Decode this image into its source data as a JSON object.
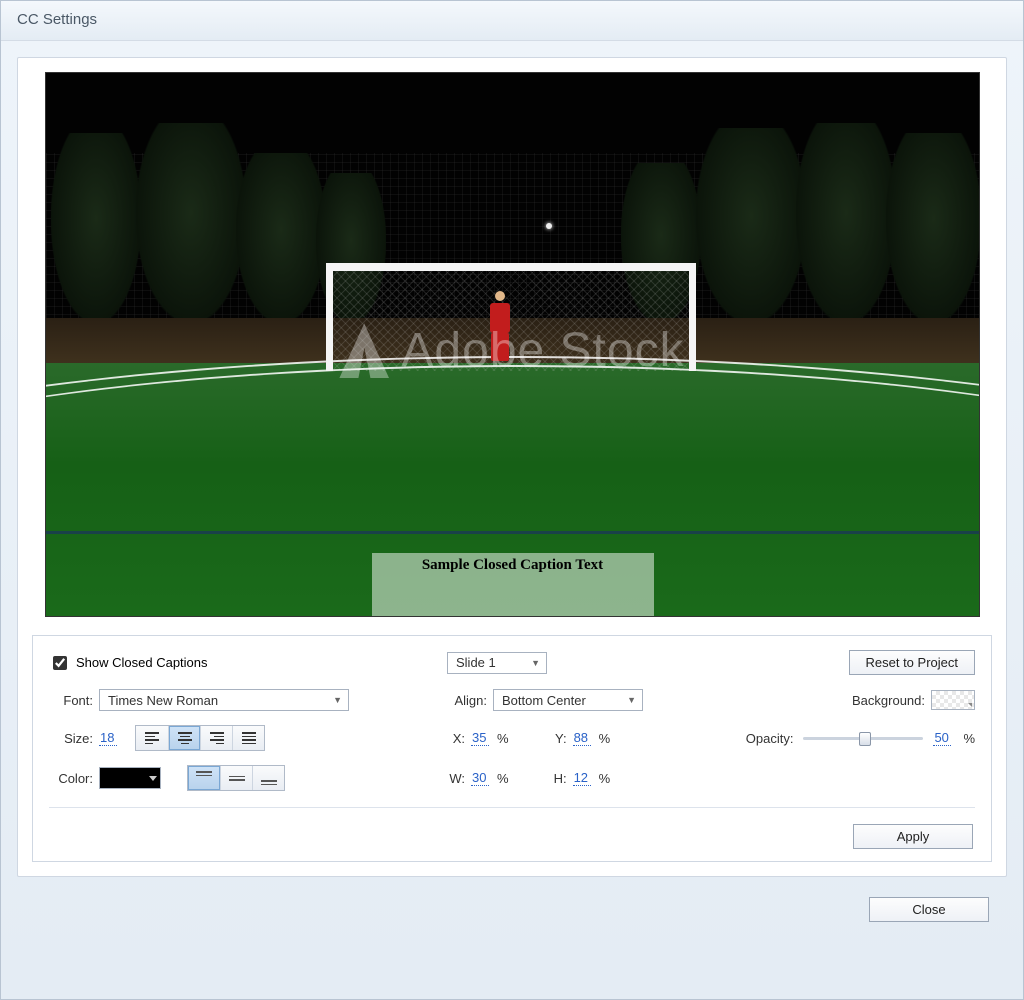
{
  "window": {
    "title": "CC Settings"
  },
  "preview": {
    "watermark_text": "Adobe Stock",
    "caption_sample": "Sample Closed Caption Text"
  },
  "controls": {
    "show_cc_label": "Show Closed Captions",
    "show_cc_checked": true,
    "slide_selector": "Slide 1",
    "reset_btn": "Reset to Project",
    "font_label": "Font:",
    "font_value": "Times New Roman",
    "size_label": "Size:",
    "size_value": "18",
    "color_label": "Color:",
    "color_value": "#000000",
    "align_label": "Align:",
    "align_value": "Bottom Center",
    "x_label": "X:",
    "x_value": "35",
    "y_label": "Y:",
    "y_value": "88",
    "w_label": "W:",
    "w_value": "30",
    "h_label": "H:",
    "h_value": "12",
    "percent": "%",
    "background_label": "Background:",
    "opacity_label": "Opacity:",
    "opacity_value": "50",
    "apply_btn": "Apply",
    "close_btn": "Close",
    "text_align_selected": "center",
    "vert_align_selected": "top"
  }
}
